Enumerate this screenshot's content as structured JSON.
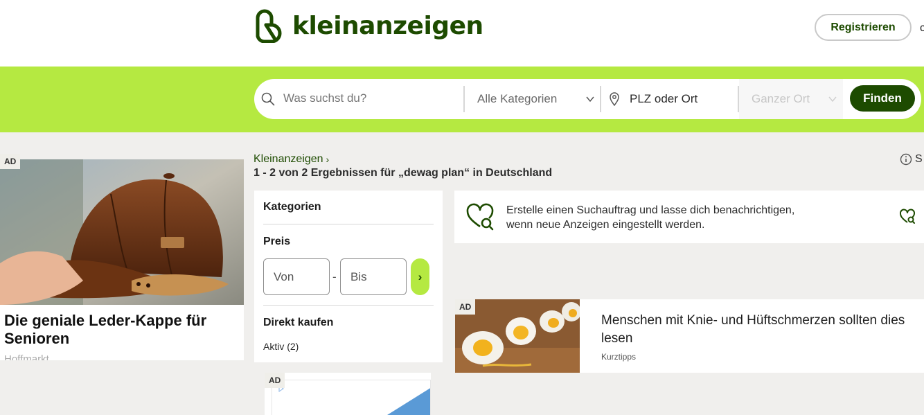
{
  "header": {
    "logo_text": "kleinanzeigen",
    "register_label": "Registrieren",
    "user_cut": "‹"
  },
  "search": {
    "query_placeholder": "Was suchst du?",
    "category": "Alle Kategorien",
    "location_placeholder": "PLZ oder Ort",
    "radius": "Ganzer Ort",
    "find_label": "Finden"
  },
  "left_ad": {
    "badge": "AD",
    "title": "Die geniale Leder-Kappe für Senioren",
    "source": "Hoffmarkt"
  },
  "breadcrumb": {
    "root": "Kleinanzeigen"
  },
  "results": {
    "title": "1 - 2 von 2 Ergebnissen für „dewag plan“ in Deutschland",
    "info_cut": "S"
  },
  "filters": {
    "categories_heading": "Kategorien",
    "price_heading": "Preis",
    "price_from": "Von",
    "price_to": "Bis",
    "price_dash": "-",
    "price_go": "›",
    "direct_heading": "Direkt kaufen",
    "direct_item": "Aktiv  (2)"
  },
  "small_ad": {
    "badge": "AD"
  },
  "save_search": {
    "text_line1": "Erstelle einen Suchauftrag und lasse dich benachrichtigen,",
    "text_line2": "wenn neue Anzeigen eingestellt werden."
  },
  "article": {
    "badge": "AD",
    "title": "Menschen mit Knie- und Hüftschmerzen sollten dies lesen",
    "source": "Kurztipps"
  },
  "colors": {
    "brand_green": "#1d4b00",
    "lime": "#b5e941",
    "background": "#f0efed"
  }
}
